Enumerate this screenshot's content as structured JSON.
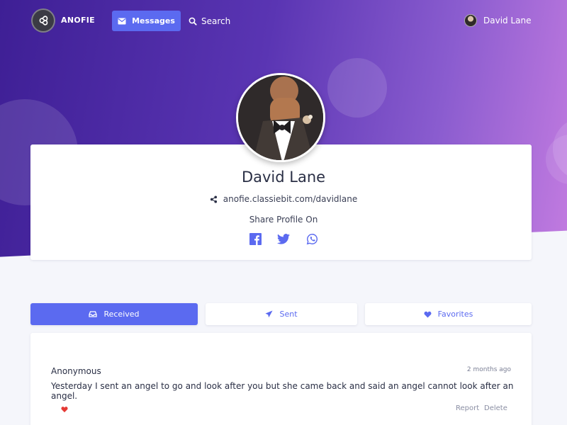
{
  "app": {
    "name": "ANOFIE",
    "brand_color": "#5b6af0",
    "logo_icon": "infinity-icon"
  },
  "nav": {
    "messages_label": "Messages",
    "messages_icon": "envelope-icon",
    "search_label": "Search",
    "search_icon": "search-icon"
  },
  "user": {
    "name": "David Lane"
  },
  "profile": {
    "name": "David Lane",
    "link": "anofie.classiebit.com/davidlane",
    "share_label": "Share Profile On",
    "share_icons": [
      "facebook-icon",
      "twitter-icon",
      "whatsapp-icon"
    ]
  },
  "tabs": [
    {
      "label": "Received",
      "icon": "inbox-icon",
      "active": true
    },
    {
      "label": "Sent",
      "icon": "paper-plane-icon",
      "active": false
    },
    {
      "label": "Favorites",
      "icon": "heart-icon",
      "active": false
    }
  ],
  "messages": [
    {
      "author": "Anonymous",
      "time": "2 months ago",
      "text": "Yesterday I sent an angel to go and look after you but she came back and said an angel cannot look after an angel.",
      "report_label": "Report",
      "delete_label": "Delete",
      "liked": true
    }
  ]
}
